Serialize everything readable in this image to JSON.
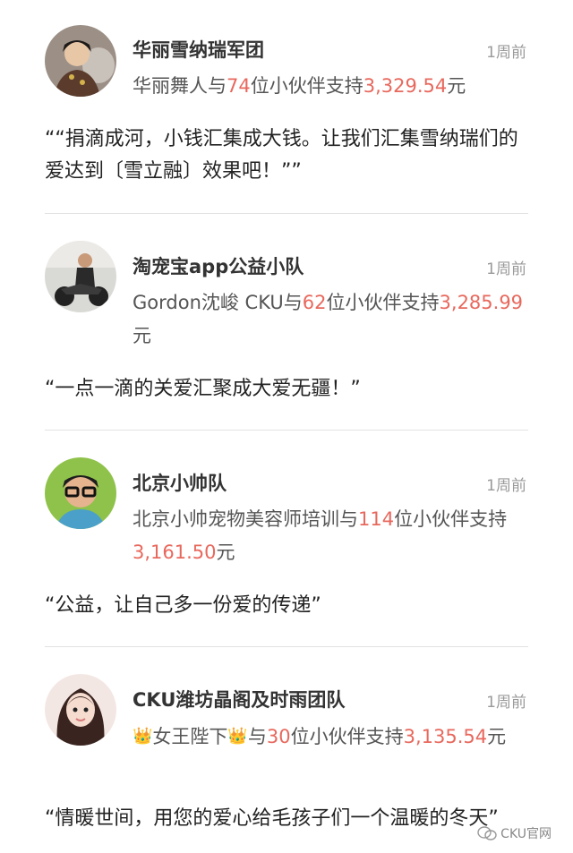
{
  "posts": [
    {
      "team": "华丽雪纳瑞军团",
      "time": "1周前",
      "supporter": "华丽舞人与",
      "count": "74",
      "mid": "位小伙伴支持",
      "amount": "3,329.54",
      "unit": "元",
      "message": "““捐滴成河，小钱汇集成大钱。让我们汇集雪纳瑞们的爱达到〔雪立融〕效果吧！””"
    },
    {
      "team": "淘宠宝app公益小队",
      "time": "1周前",
      "supporter": "Gordon沈峻 CKU与",
      "count": "62",
      "mid": "位小伙伴支持",
      "amount": "3,285.99",
      "unit": "元",
      "message": "“一点一滴的关爱汇聚成大爱无疆！”"
    },
    {
      "team": "北京小帅队",
      "time": "1周前",
      "supporter": "北京小帅宠物美容师培训与",
      "count": "114",
      "mid": "位小伙伴支持",
      "amount": "3,161.50",
      "unit": "元",
      "message": "“公益，让自己多一份爱的传递”"
    },
    {
      "team": "CKU潍坊晶阁及时雨团队",
      "time": "1周前",
      "supporter": "女王陛下",
      "supporter_crown": "crown-emoji",
      "count": "30",
      "mid": "位小伙伴支持",
      "amount": "3,135.54",
      "unit": "元",
      "message": "“情暖世间，用您的爱心给毛孩子们一个温暖的冬天”"
    }
  ],
  "watermark": "CKU官网",
  "colors": {
    "highlight": "#e8685d",
    "time": "#9a9a9a",
    "divider": "#e2e2e2"
  }
}
